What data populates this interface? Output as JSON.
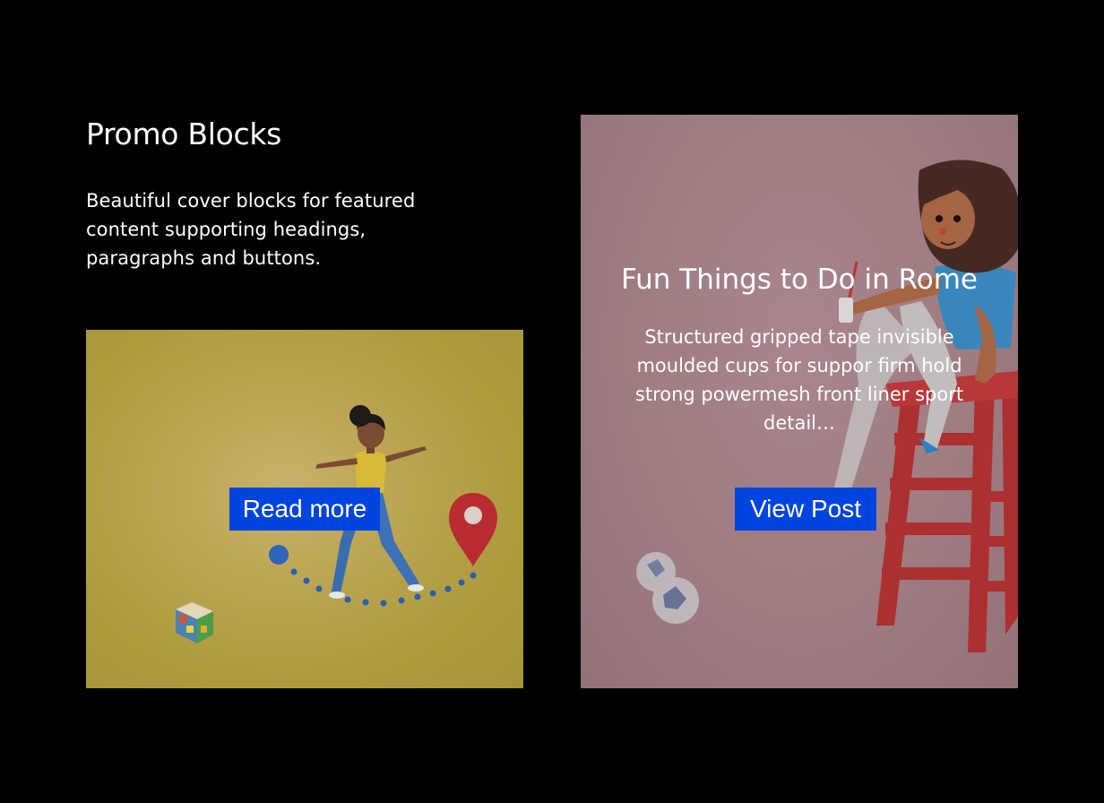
{
  "intro": {
    "title": "Promo Blocks",
    "description": "Beautiful cover blocks for featured content supporting headings, paragraphs and buttons."
  },
  "card_left": {
    "button_label": "Read more",
    "illustration": "woman-walking-path-to-location-pin",
    "colors": {
      "background": "#b19d44",
      "button": "#0044e0",
      "pin": "#c0272d"
    }
  },
  "card_right": {
    "title": "Fun Things to Do in Rome",
    "description": "Structured gripped tape invisible moulded cups for suppor firm hold strong powermesh front liner sport detail…",
    "button_label": "View Post",
    "illustration": "woman-sitting-on-red-ladder",
    "colors": {
      "background": "#a8868b",
      "button": "#0044e0",
      "ladder": "#c83a3a"
    }
  }
}
